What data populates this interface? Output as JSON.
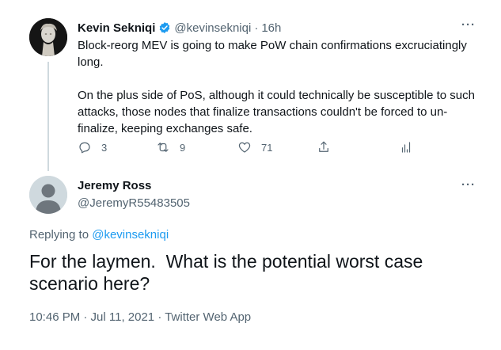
{
  "tweet1": {
    "author_name": "Kevin Sekniqi",
    "author_handle": "@kevinsekniqi",
    "separator": "·",
    "time": "16h",
    "paragraph1": "Block-reorg MEV is going to make PoW chain confirmations excruciatingly long.",
    "paragraph2": "On the plus side of PoS, although it could technically be susceptible to such attacks, those nodes that finalize transactions couldn't be forced to un-finalize, keeping exchanges safe.",
    "more_label": "···",
    "reply_count": "3",
    "retweet_count": "9",
    "like_count": "71",
    "verified_color": "#1d9bf0"
  },
  "tweet2": {
    "author_name": "Jeremy Ross",
    "author_handle": "@JeremyR55483505",
    "more_label": "···",
    "replying_prefix": "Replying to",
    "replying_to": "@kevinsekniqi",
    "text": "For the laymen.  What is the potential worst case scenario here?",
    "meta": "10:46 PM · Jul 11, 2021 · Twitter Web App"
  },
  "colors": {
    "link": "#1d9bf0",
    "muted": "#536471",
    "text": "#0f1419"
  }
}
